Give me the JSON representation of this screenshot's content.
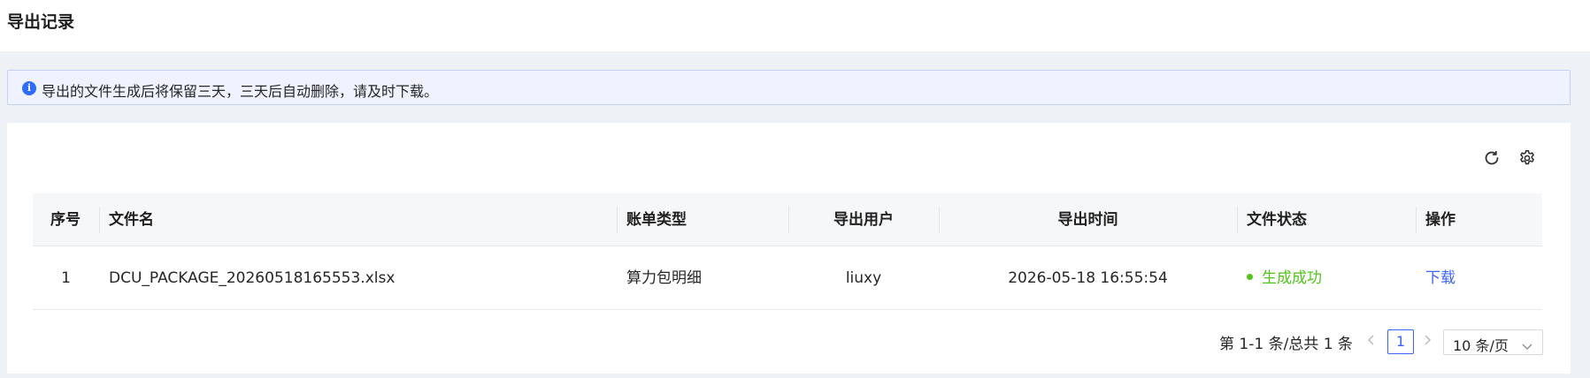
{
  "page": {
    "title": "导出记录"
  },
  "notice": {
    "icon": "info-icon",
    "text": "导出的文件生成后将保留三天，三天后自动删除，请及时下载。"
  },
  "toolbar": {
    "refresh_icon": "refresh-icon",
    "settings_icon": "gear-icon"
  },
  "table": {
    "columns": [
      "序号",
      "文件名",
      "账单类型",
      "导出用户",
      "导出时间",
      "文件状态",
      "操作"
    ],
    "rows": [
      {
        "index": "1",
        "filename": "DCU_PACKAGE_20260518165553.xlsx",
        "bill_type": "算力包明细",
        "user": "liuxy",
        "time": "2026-05-18 16:55:54",
        "status": "生成成功",
        "action": "下载"
      }
    ]
  },
  "pagination": {
    "total_text": "第 1-1 条/总共 1 条",
    "current_page": "1",
    "page_size": "10 条/页"
  },
  "colors": {
    "primary": "#3b63ff",
    "success": "#52c41a",
    "notice_bg": "#eef3ff"
  }
}
